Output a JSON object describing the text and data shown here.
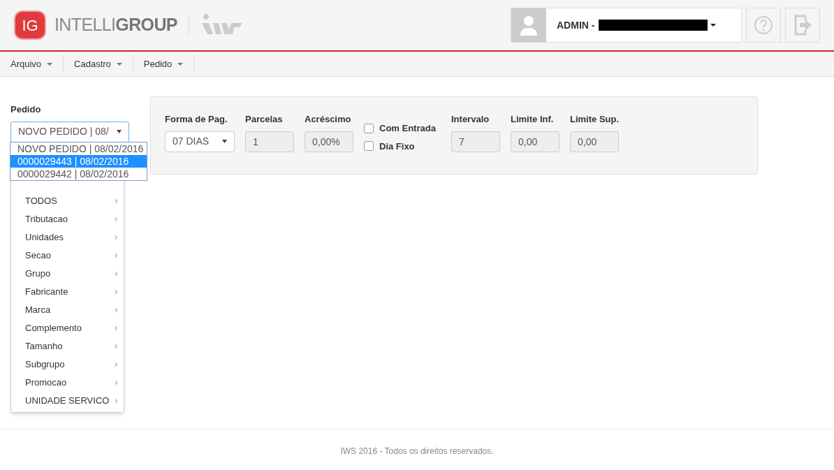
{
  "logo": {
    "badge": "IG",
    "name_light": "INTELLI",
    "name_bold": "GROUP"
  },
  "user": {
    "label": "ADMIN -"
  },
  "menu": [
    {
      "label": "Arquivo"
    },
    {
      "label": "Cadastro"
    },
    {
      "label": "Pedido"
    }
  ],
  "pedido": {
    "label": "Pedido",
    "value": "NOVO PEDIDO | 08/",
    "options": [
      {
        "label": "NOVO PEDIDO | 08/02/2016",
        "selected": false
      },
      {
        "label": "0000029443 | 08/02/2016",
        "selected": true
      },
      {
        "label": "0000029442 | 08/02/2016",
        "selected": false
      }
    ]
  },
  "context_menu": [
    {
      "label": "TODOS"
    },
    {
      "label": "Tributacao"
    },
    {
      "label": "Unidades"
    },
    {
      "label": "Secao"
    },
    {
      "label": "Grupo"
    },
    {
      "label": "Fabricante"
    },
    {
      "label": "Marca"
    },
    {
      "label": "Complemento"
    },
    {
      "label": "Tamanho"
    },
    {
      "label": "Subgrupo"
    },
    {
      "label": "Promocao"
    },
    {
      "label": "UNIDADE SERVICO"
    }
  ],
  "payment": {
    "fields": [
      {
        "kind": "select",
        "label": "Forma de Pag.",
        "value": "07 DIAS"
      },
      {
        "kind": "input",
        "label": "Parcelas",
        "value": "1"
      },
      {
        "kind": "input",
        "label": "Acréscimo",
        "value": "0,00%"
      },
      {
        "kind": "checks",
        "items": [
          {
            "label": "Com Entrada",
            "checked": false
          },
          {
            "label": "Dia Fixo",
            "checked": false
          }
        ]
      },
      {
        "kind": "input",
        "label": "Intervalo",
        "value": "7"
      },
      {
        "kind": "input",
        "label": "Limite Inf.",
        "value": "0,00"
      },
      {
        "kind": "input",
        "label": "Limite Sup.",
        "value": "0,00"
      }
    ]
  },
  "footer": "IWS 2016 - Todos os direitos reservados."
}
